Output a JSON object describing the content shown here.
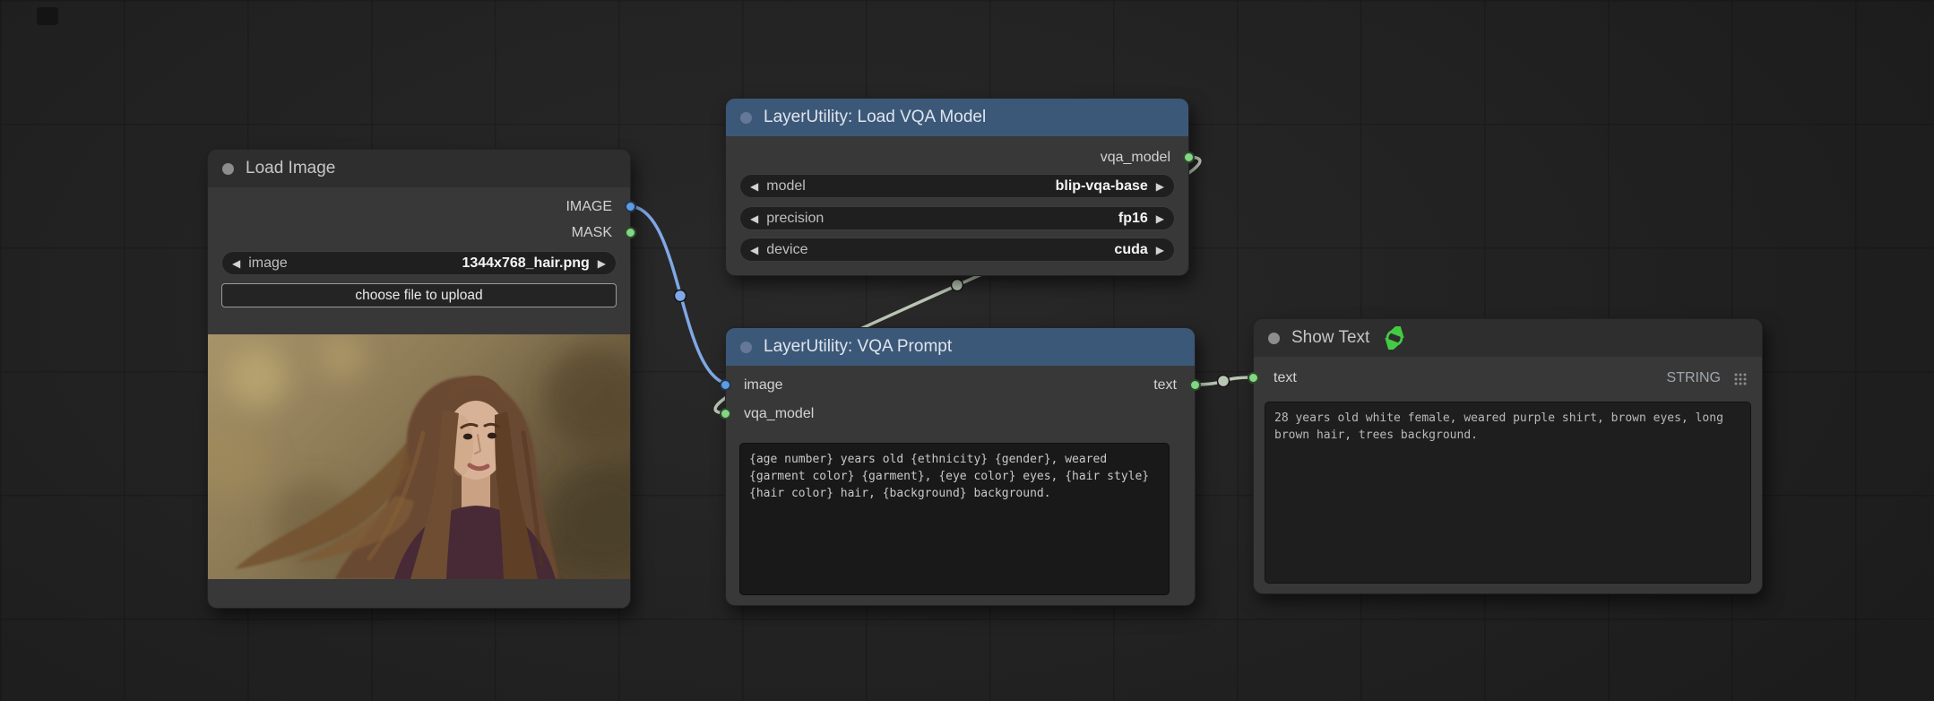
{
  "colors": {
    "canvas_bg": "#242424",
    "grid_line": "#1d1d1d",
    "node_body": "#383838",
    "dark_header": "#2e2e2e",
    "blue_header": "#3c5878",
    "blue_port": "#5d9ce0",
    "green_port": "#83d683",
    "image_link": "#7fa8e6",
    "model_link": "#b9c6b4",
    "refresh_icon": "#44cb44"
  },
  "nodes": {
    "load_image": {
      "title": "Load Image",
      "outputs": [
        {
          "name": "IMAGE"
        },
        {
          "name": "MASK"
        }
      ],
      "widgets": [
        {
          "label": "image",
          "value": "1344x768_hair.png"
        }
      ],
      "upload_button": "choose file to upload",
      "preview_alt": "Photo preview: young woman with long brown hair over a blurred warm outdoor background"
    },
    "load_vqa_model": {
      "title": "LayerUtility: Load VQA Model",
      "outputs": [
        {
          "name": "vqa_model"
        }
      ],
      "widgets": [
        {
          "label": "model",
          "value": "blip-vqa-base"
        },
        {
          "label": "precision",
          "value": "fp16"
        },
        {
          "label": "device",
          "value": "cuda"
        }
      ]
    },
    "vqa_prompt": {
      "title": "LayerUtility: VQA Prompt",
      "inputs": [
        {
          "name": "image"
        },
        {
          "name": "vqa_model"
        }
      ],
      "outputs": [
        {
          "name": "text"
        }
      ],
      "prompt_text": "{age number} years old {ethnicity} {gender}, weared {garment color} {garment}, {eye color} eyes, {hair style} {hair color} hair, {background} background."
    },
    "show_text": {
      "title": "Show Text",
      "inputs": [
        {
          "name": "text"
        }
      ],
      "type_label": "STRING",
      "text_value": "28 years old white female, weared purple shirt, brown eyes, long brown hair, trees background."
    }
  }
}
